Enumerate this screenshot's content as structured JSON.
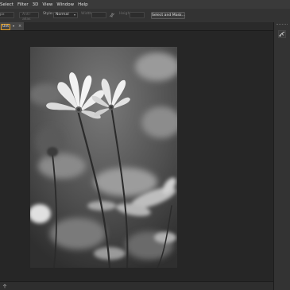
{
  "menubar": {
    "items": [
      "Select",
      "Filter",
      "3D",
      "View",
      "Window",
      "Help"
    ]
  },
  "options": {
    "field1_value": "px",
    "anti_alias_label": "Anti-alias",
    "style_label": "Style:",
    "style_value": "Normal",
    "width_label": "Width:",
    "height_label": "Height:",
    "select_mask_label": "Select and Mask..."
  },
  "document": {
    "tab_title": "Unt",
    "tab_caret": "▾",
    "tab_close": "×"
  },
  "colors": {
    "accent": "#e8a021",
    "chrome": "#333333",
    "canvas": "#262626"
  },
  "icons": {
    "swap": "swap-arrows-icon",
    "panel": "history-brush-icon",
    "status": "share-icon"
  }
}
